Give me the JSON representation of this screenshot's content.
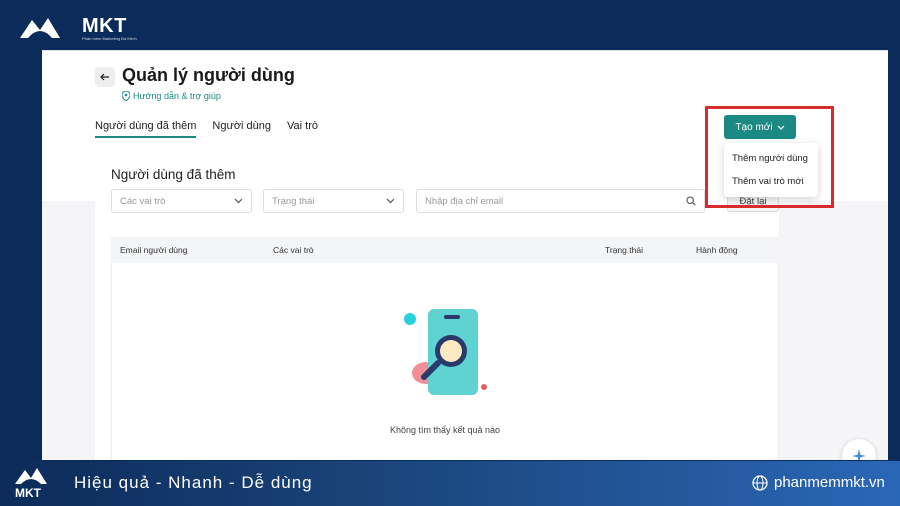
{
  "brand": {
    "name": "MKT",
    "subtitle": "Phần mềm Marketing Đa Kênh"
  },
  "header": {
    "title": "Quản lý người dùng",
    "help": "Hướng dẫn & trợ giúp"
  },
  "tabs": [
    {
      "label": "Người dùng đã thêm",
      "active": true
    },
    {
      "label": "Người dùng"
    },
    {
      "label": "Vai trò"
    }
  ],
  "create_button": "Tạo mới",
  "dropdown_items": [
    "Thêm người dùng",
    "Thêm vai trò mới"
  ],
  "reset_button": "Đặt lại",
  "card": {
    "title": "Người dùng đã thêm",
    "role_placeholder": "Các vai trò",
    "status_placeholder": "Trạng thái",
    "email_placeholder": "Nhập địa chỉ email"
  },
  "table": {
    "columns": [
      "Email người dùng",
      "Các vai trò",
      "Trạng thái",
      "Hành động"
    ],
    "empty_text": "Không tìm thấy kết quả nào"
  },
  "footer": {
    "logo": "MKT",
    "tagline": "Hiệu quả - Nhanh  - Dễ dùng",
    "website": "phanmemmkt.vn"
  },
  "colors": {
    "accent": "#1b8a83",
    "highlight": "#d82b2b",
    "background": "#0b2b5a"
  }
}
